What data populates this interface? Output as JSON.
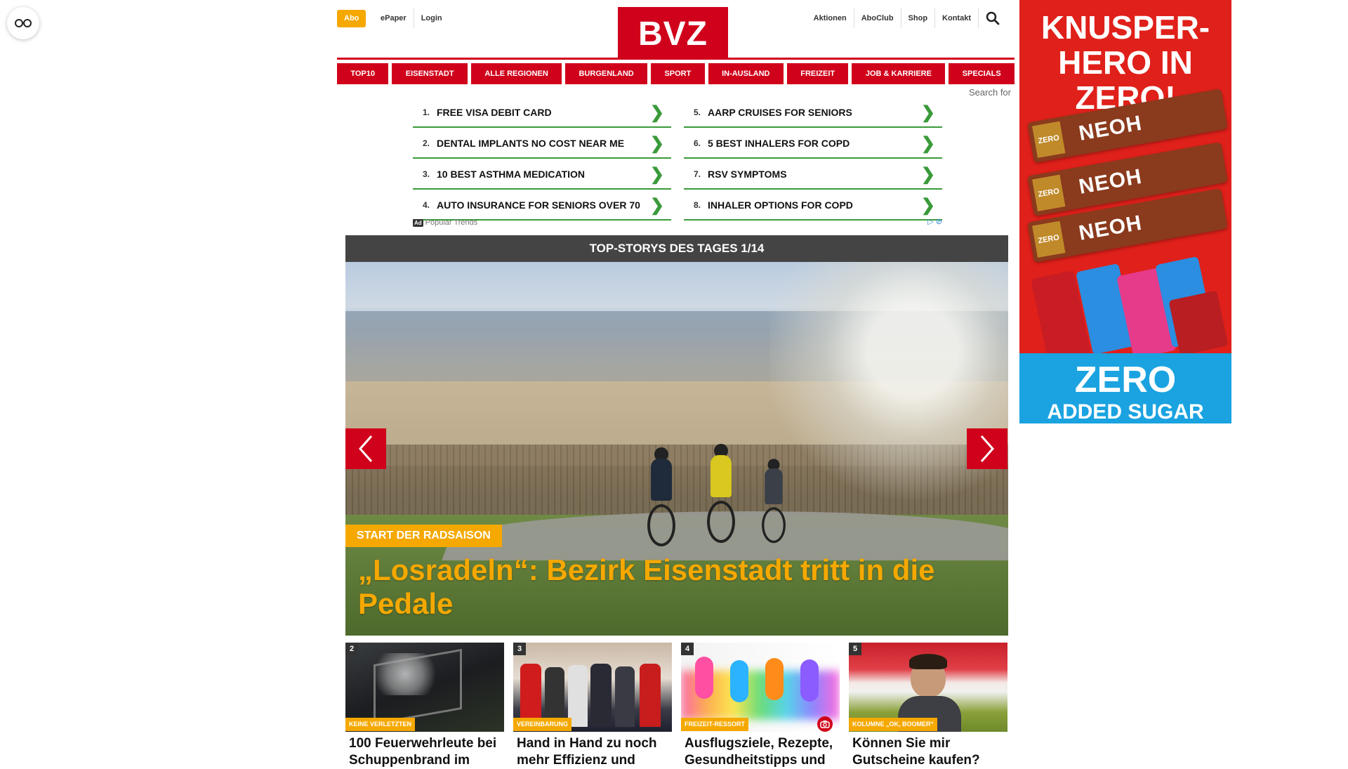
{
  "header": {
    "abo_label": "Abo",
    "links_left": [
      "ePaper",
      "Login"
    ],
    "logo_text": "BVZ",
    "links_right": [
      "Aktionen",
      "AboClub",
      "Shop",
      "Kontakt"
    ]
  },
  "nav": {
    "items": [
      "TOP10",
      "EISENSTADT",
      "ALLE REGIONEN",
      "BURGENLAND",
      "SPORT",
      "IN-AUSLAND",
      "FREIZEIT",
      "JOB & KARRIERE",
      "SPECIALS"
    ]
  },
  "search_for": "Search for",
  "ad_links": {
    "left": [
      {
        "num": "1.",
        "text": "FREE VISA DEBIT CARD"
      },
      {
        "num": "2.",
        "text": "DENTAL IMPLANTS NO COST NEAR ME"
      },
      {
        "num": "3.",
        "text": "10 BEST ASTHMA MEDICATION"
      },
      {
        "num": "4.",
        "text": "AUTO INSURANCE FOR SENIORS OVER 70"
      }
    ],
    "right": [
      {
        "num": "5.",
        "text": "AARP CRUISES FOR SENIORS"
      },
      {
        "num": "6.",
        "text": "5 BEST INHALERS FOR COPD"
      },
      {
        "num": "7.",
        "text": "RSV SYMPTOMS"
      },
      {
        "num": "8.",
        "text": "INHALER OPTIONS FOR COPD"
      }
    ],
    "badge": "Ad",
    "footer": "Popular Trends"
  },
  "top_stories": {
    "header": "TOP-STORYS DES TAGES 1/14",
    "kicker": "START DER RADSAISON",
    "headline": "„Losradeln“: Bezirk Eisenstadt tritt in die Pedale"
  },
  "cards": [
    {
      "num": "2",
      "tag": "KEINE VERLETZTEN",
      "title": "100 Feuerwehrleute bei Schuppenbrand im"
    },
    {
      "num": "3",
      "tag": "VEREINBARUNG",
      "title": "Hand in Hand zu noch mehr Effizienz und"
    },
    {
      "num": "4",
      "tag": "FREIZEIT-RESSORT",
      "title": "Ausflugsziele, Rezepte, Gesundheitstipps und"
    },
    {
      "num": "5",
      "tag": "KOLUMNE „OK, BOOMER“",
      "title": "Können Sie mir Gutscheine kaufen?"
    }
  ],
  "side_ad": {
    "headline": "KNUSPER-HERO IN ZERO!",
    "brand": "NEOH",
    "bar_label": "ZERO",
    "bottom1": "ZERO",
    "bottom2": "ADDED SUGAR"
  },
  "colors": {
    "brand_red": "#d0021b",
    "accent_yellow": "#f5a800",
    "ad_green": "#3a9a3a"
  }
}
